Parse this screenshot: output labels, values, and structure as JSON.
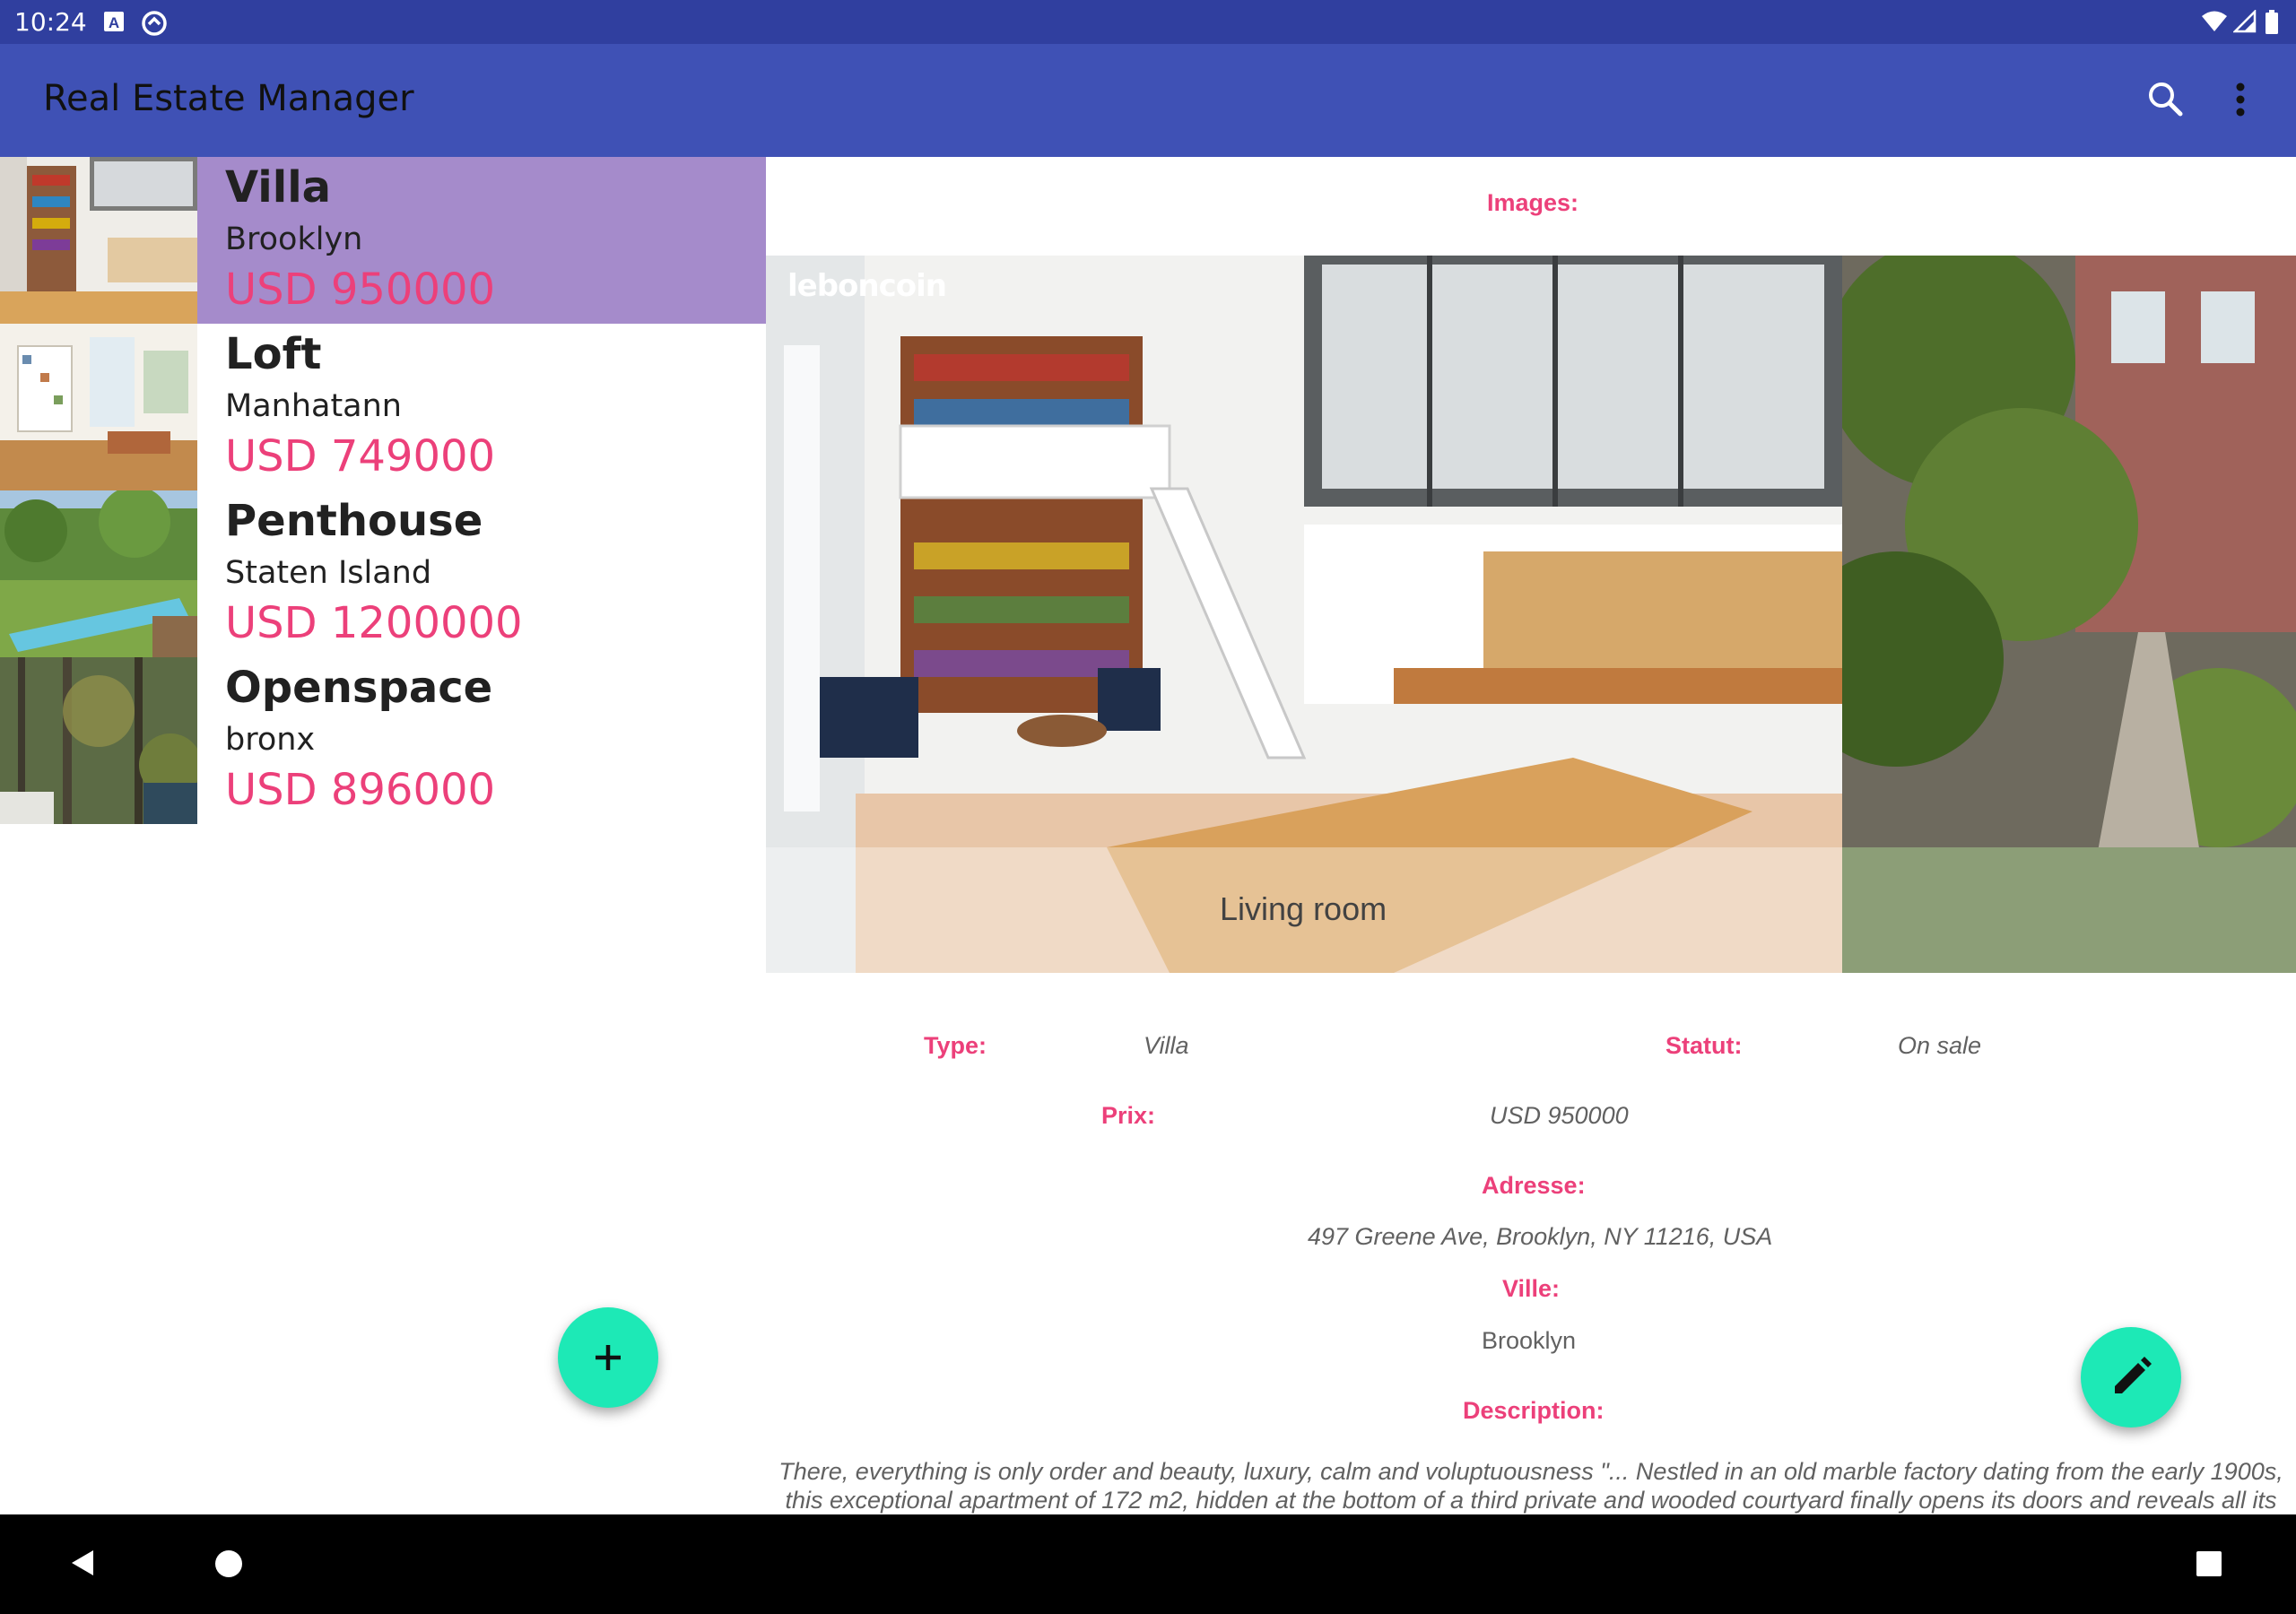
{
  "status_bar": {
    "time": "10:24",
    "left_icons": [
      "keyboard-a-icon",
      "sync-circle-icon"
    ],
    "right_icons": [
      "wifi-icon",
      "signal-icon",
      "battery-icon"
    ]
  },
  "app_bar": {
    "title": "Real Estate Manager",
    "actions": [
      "search-icon",
      "more-vert-icon"
    ],
    "color": "#3F51B5"
  },
  "list": {
    "items": [
      {
        "type": "Villa",
        "city": "Brooklyn",
        "price": "USD 950000",
        "selected": true,
        "thumb": "interior-loft"
      },
      {
        "type": "Loft",
        "city": "Manhatann",
        "price": "USD 749000",
        "selected": false,
        "thumb": "living-room"
      },
      {
        "type": "Penthouse",
        "city": "Staten Island",
        "price": "USD 1200000",
        "selected": false,
        "thumb": "garden-pool"
      },
      {
        "type": "Openspace",
        "city": "bronx",
        "price": "USD 896000",
        "selected": false,
        "thumb": "forest"
      }
    ],
    "selected_color": "#A58BCB",
    "price_color": "#EC407A",
    "add_button_icon": "plus-icon"
  },
  "detail": {
    "images_label": "Images:",
    "gallery": [
      {
        "caption": "Living room",
        "watermark": "leboncoin"
      },
      {
        "caption": ""
      }
    ],
    "type_label": "Type:",
    "type_value": "Villa",
    "status_label": "Statut:",
    "status_value": "On sale",
    "price_label": "Prix:",
    "price_value": "USD 950000",
    "address_label": "Adresse:",
    "address_value": "497 Greene Ave, Brooklyn, NY 11216, USA",
    "city_label": "Ville:",
    "city_value": "Brooklyn",
    "description_label": "Description:",
    "description_line1": "There, everything is only order and beauty, luxury, calm and voluptuousness \"... Nestled in an old marble factory dating from the early 1900s,",
    "description_line2": "this exceptional apartment of 172 m2, hidden at the bottom of a third private and wooded courtyard finally opens its doors and reveals all its",
    "edit_button_icon": "pencil-icon",
    "label_color": "#EC407A"
  },
  "fab_color": "#1DE9B6",
  "nav_bar": {
    "buttons": [
      "back-icon",
      "home-icon",
      "recents-icon"
    ]
  }
}
